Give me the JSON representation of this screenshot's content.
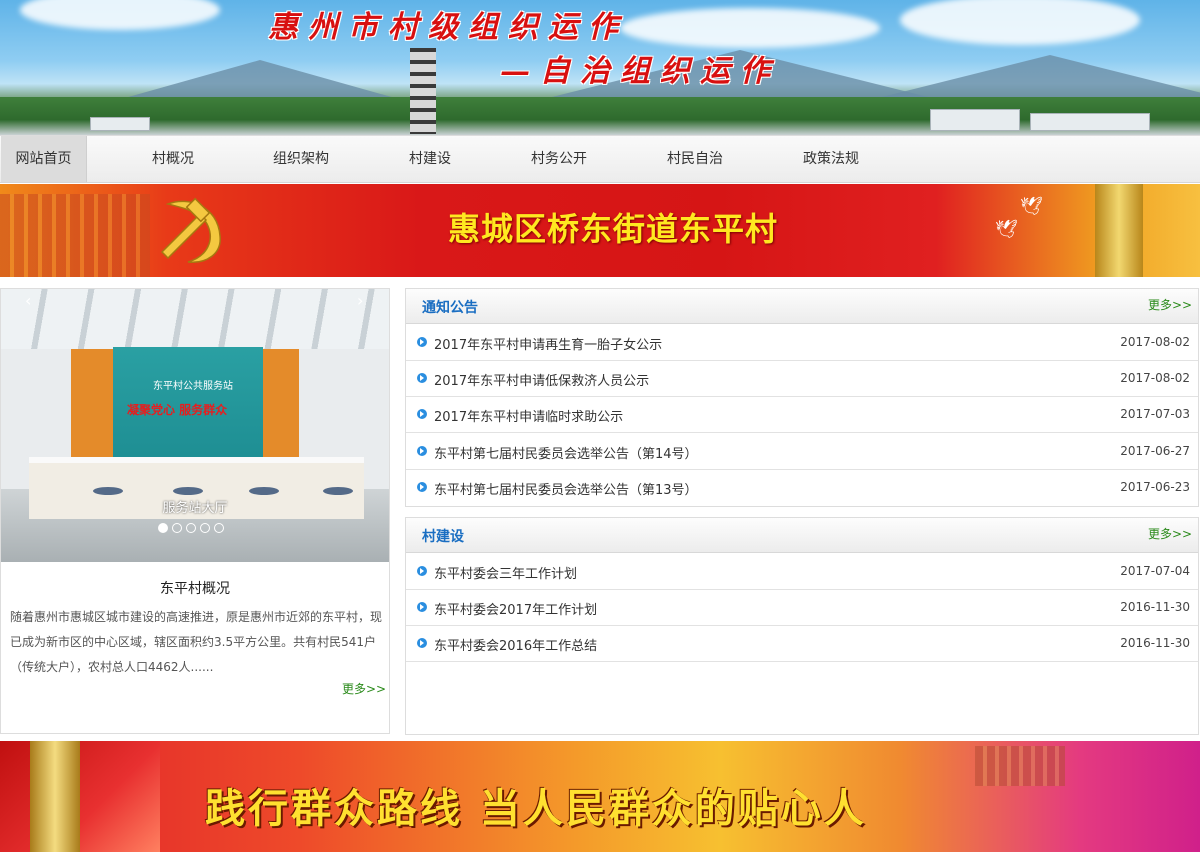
{
  "header": {
    "title_line1": "惠州市村级组织运作",
    "title_line2": "—自治组织运作"
  },
  "nav": {
    "items": [
      {
        "label": "网站首页",
        "active": true
      },
      {
        "label": "村概况"
      },
      {
        "label": "组织架构"
      },
      {
        "label": "村建设"
      },
      {
        "label": "村务公开"
      },
      {
        "label": "村民自治"
      },
      {
        "label": "政策法规"
      }
    ]
  },
  "party_banner": {
    "title": "惠城区桥东街道东平村"
  },
  "slider": {
    "caption": "服务站大厅",
    "board_title": "东平村公共服务站",
    "board_slogan": "凝聚党心 服务群众",
    "prev": "‹",
    "next": "›",
    "dot_count": 5,
    "active_dot": 1
  },
  "overview": {
    "title": "东平村概况",
    "text": "随着惠州市惠城区城市建设的高速推进，原是惠州市近郊的东平村，现已成为新市区的中心区域，辖区面积约3.5平方公里。共有村民541户（传统大户），农村总人口4462人......",
    "more": "更多>>"
  },
  "notices": {
    "title": "通知公告",
    "more": "更多>>",
    "items": [
      {
        "title": "2017年东平村申请再生育一胎子女公示",
        "date": "2017-08-02"
      },
      {
        "title": "2017年东平村申请低保救济人员公示",
        "date": "2017-08-02"
      },
      {
        "title": "2017年东平村申请临时求助公示",
        "date": "2017-07-03"
      },
      {
        "title": "东平村第七届村民委员会选举公告（第14号）",
        "date": "2017-06-27"
      },
      {
        "title": "东平村第七届村民委员会选举公告（第13号）",
        "date": "2017-06-23"
      }
    ]
  },
  "construction": {
    "title": "村建设",
    "more": "更多>>",
    "items": [
      {
        "title": "东平村委会三年工作计划",
        "date": "2017-07-04"
      },
      {
        "title": "东平村委会2017年工作计划",
        "date": "2016-11-30"
      },
      {
        "title": "东平村委会2016年工作总结",
        "date": "2016-11-30"
      }
    ]
  },
  "bottom_banner": {
    "slogan": "践行群众路线  当人民群众的贴心人"
  }
}
